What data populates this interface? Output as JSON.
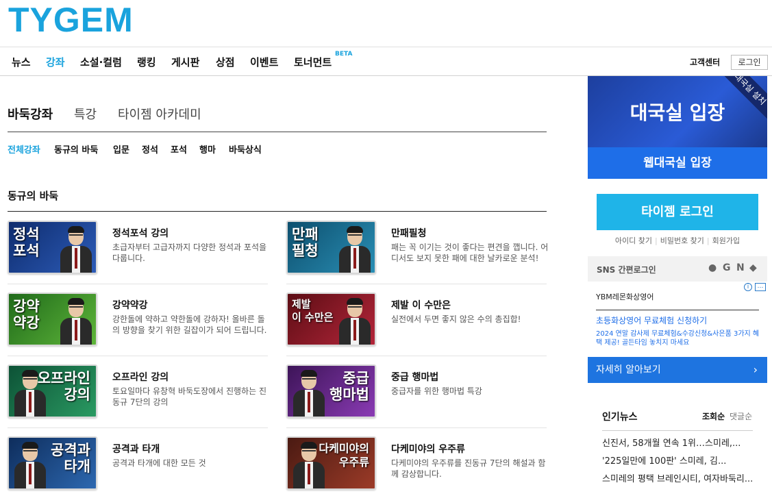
{
  "logo": "TYGEM",
  "nav": {
    "items": [
      "뉴스",
      "강좌",
      "소설·컬럼",
      "랭킹",
      "게시판",
      "상점",
      "이벤트",
      "토너먼트"
    ],
    "beta": "BETA",
    "customer_center": "고객센터",
    "login": "로그인"
  },
  "tabs": [
    "바둑강좌",
    "특강",
    "타이젬 아카데미"
  ],
  "subtabs": [
    "전체강좌",
    "동규의 바둑",
    "입문",
    "정석",
    "포석",
    "행마",
    "바둑상식"
  ],
  "section_title": "동규의 바둑",
  "courses": [
    {
      "thumb": "정석\n포석",
      "title": "정석포석 강의",
      "desc": "초급자부터 고급자까지 다양한 정석과 포석을 다룹니다."
    },
    {
      "thumb": "만패\n필청",
      "title": "만패필청",
      "desc": "패는 꼭 이기는 것이 좋다는 편견을 깹니다. 어디서도 보지 못한 패에 대한 날카로운 분석!"
    },
    {
      "thumb": "강약\n약강",
      "title": "강약약강",
      "desc": "강한돌에 약하고 약한돌에 강하자! 올바른 돌의 방향을 찾기 위한 길잡이가 되어 드립니다."
    },
    {
      "thumb": "제발\n이 수만은",
      "title": "제발 이 수만은",
      "desc": "실전에서 두면 좋지 않은 수의 총집합!"
    },
    {
      "thumb": "오프라인\n강의",
      "title": "오프라인 강의",
      "desc": "토요일마다 유창혁 바둑도장에서 진행하는 진동규 7단의 강의"
    },
    {
      "thumb": "중급\n행마법",
      "title": "중급 행마법",
      "desc": "중급자를 위한 행마법 특강"
    },
    {
      "thumb": "공격과\n타개",
      "title": "공격과 타개",
      "desc": "공격과 타개에 대한 모든 것"
    },
    {
      "thumb": "다케미야의\n우주류",
      "title": "다케미야의 우주류",
      "desc": "다케미야의 우주류를 진동규 7단의 해설과 함께 감상합니다."
    }
  ],
  "sidebar": {
    "game_room": "대국실 입장",
    "game_install": "대국실 설치",
    "web_room": "웹대국실 입장",
    "tygem_login": "타이젬 로그인",
    "find_id": "아이디 찾기",
    "find_pw": "비밀번호 찾기",
    "join": "회원가입",
    "sns_label": "SNS 간편로그인",
    "sns_icons": [
      "G",
      "N"
    ],
    "ad": {
      "brand": "YBM레몬화상영어",
      "headline": "초등화상영어 무료체험 신청하기",
      "sub": "2024 연말 감사제 무료체험&수강신청&사은품 3가지 혜택 제공! 골든타임 놓치지 마세요",
      "cta": "자세히 알아보기"
    },
    "news": {
      "title": "인기뉴스",
      "sort_views": "조회순",
      "sort_comments": "댓글순",
      "items": [
        "신진서, 58개월 연속 1위…스미레,...",
        "'225일만에 100판' 스미레, 김...",
        "스미레의 평택 브레인시티, 여자바둑리..."
      ]
    }
  }
}
